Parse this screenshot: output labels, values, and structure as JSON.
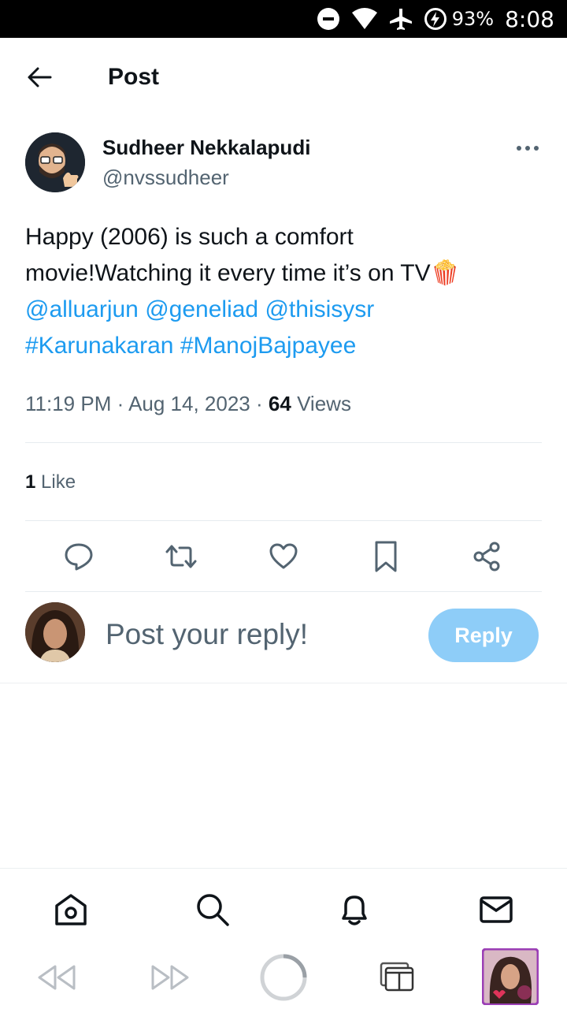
{
  "status_bar": {
    "battery": "93%",
    "time": "8:08"
  },
  "header": {
    "title": "Post"
  },
  "post": {
    "author_name": "Sudheer Nekkalapudi",
    "author_handle": "@nvssudheer",
    "text_line1": "Happy (2006) is such a comfort",
    "text_line2": "movie!Watching it every time it’s on TV",
    "text_emoji": "🍿",
    "mentions": [
      "@alluarjun",
      "@geneliad",
      "@thisisysr"
    ],
    "hashtags": [
      "#Karunakaran",
      "#ManojBajpayee"
    ],
    "time": "11:19 PM",
    "date": "Aug 14, 2023",
    "separator": "·",
    "views_count": "64",
    "views_label": "Views",
    "likes_count": "1",
    "likes_label": "Like"
  },
  "reply": {
    "placeholder": "Post your reply!",
    "button_label": "Reply"
  },
  "colors": {
    "link": "#1d9bf0",
    "reply_button": "#8ecdf8",
    "secondary_text": "#536471"
  }
}
